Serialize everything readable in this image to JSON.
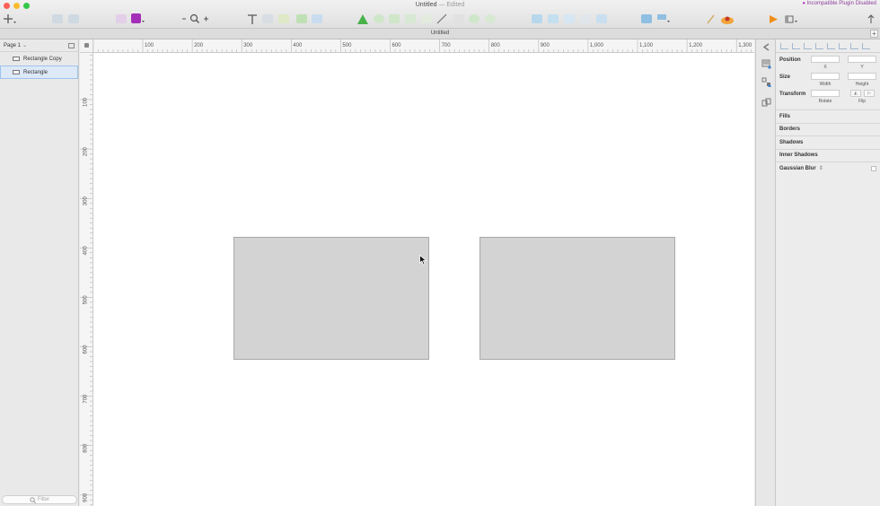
{
  "window": {
    "title": "Untitled",
    "edited_label": "— Edited",
    "plugin_warning": "Incompatible Plugin Disabled",
    "document_tab": "Untitled"
  },
  "layers_panel": {
    "page_label": "Page 1",
    "layers": [
      {
        "name": "Rectangle Copy",
        "selected": false
      },
      {
        "name": "Rectangle",
        "selected": true
      }
    ],
    "filter_placeholder": "Filter"
  },
  "rulers": {
    "horizontal": [
      "100",
      "200",
      "300",
      "400",
      "500",
      "600",
      "700",
      "800",
      "900",
      "1,000",
      "1,100",
      "1,200",
      "1,300"
    ],
    "vertical": [
      "100",
      "200",
      "300",
      "400",
      "500",
      "600",
      "700",
      "800",
      "900"
    ]
  },
  "canvas": {
    "shape_fill": "#d3d3d3",
    "shape_border": "#a8a8a8"
  },
  "inspector": {
    "position_label": "Position",
    "x_label": "X",
    "y_label": "Y",
    "size_label": "Size",
    "width_label": "Width",
    "height_label": "Height",
    "transform_label": "Transform",
    "rotate_label": "Rotate",
    "flip_label": "Flip",
    "sections": [
      "Fills",
      "Borders",
      "Shadows",
      "Inner Shadows",
      "Gaussian Blur"
    ]
  },
  "colors": {
    "selection": "#dde9f7",
    "close": "#fc5f57",
    "minimize": "#fdbc2e",
    "zoom": "#33c748",
    "plugin_warning": "#8c3e9a"
  }
}
